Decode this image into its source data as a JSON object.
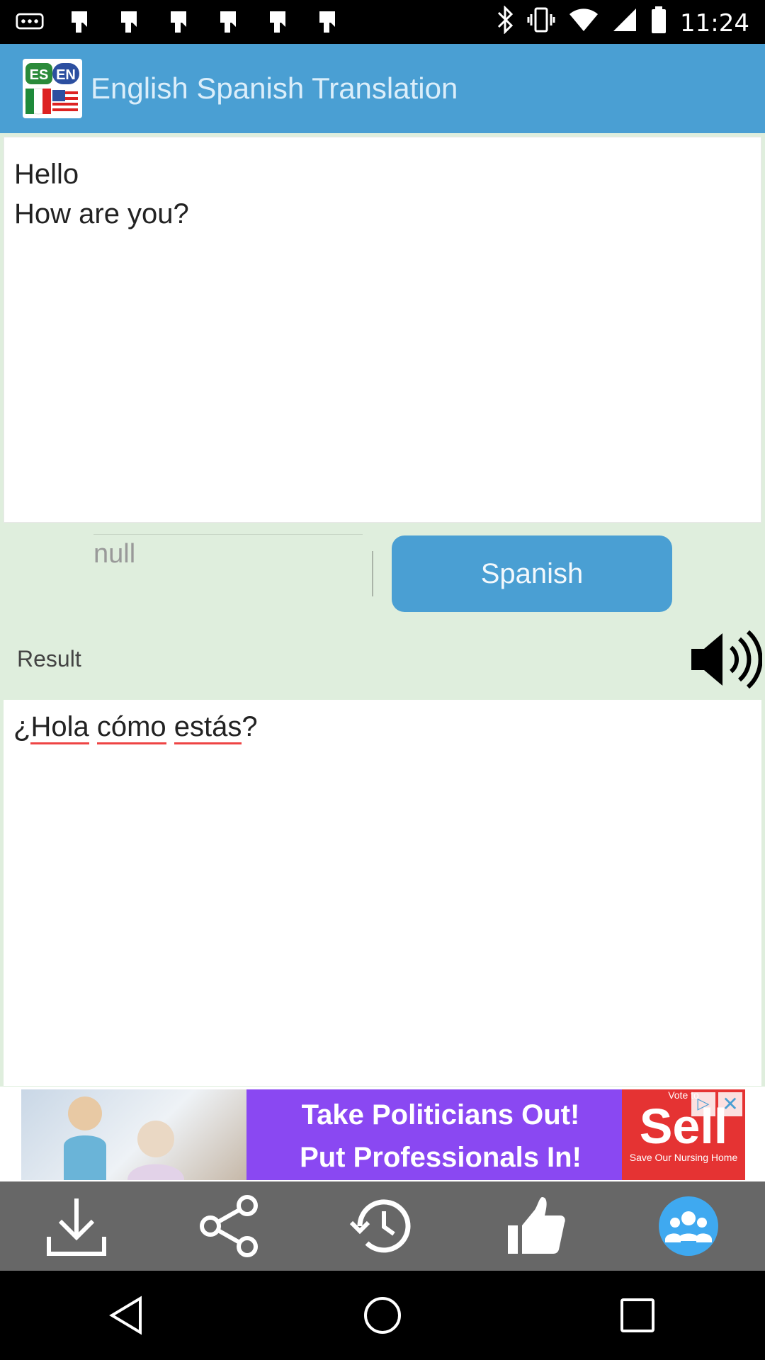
{
  "status_bar": {
    "time": "11:24",
    "left_icons": [
      "more-icon",
      "notification-icon",
      "notification-icon",
      "notification-icon",
      "notification-icon",
      "notification-icon",
      "notification-icon"
    ],
    "right_icons": [
      "bluetooth-icon",
      "vibrate-icon",
      "wifi-icon",
      "signal-icon",
      "battery-icon"
    ]
  },
  "app_bar": {
    "title": "English Spanish Translation",
    "logo_text_es": "ES",
    "logo_text_en": "EN"
  },
  "input": {
    "text": "Hello\nHow are you?"
  },
  "language": {
    "source": "null",
    "target": "Spanish"
  },
  "result": {
    "label": "Result",
    "prefix": "¿",
    "words": [
      "Hola",
      "cómo",
      "estás"
    ],
    "suffix": "?"
  },
  "ad": {
    "line1": "Take Politicians Out!",
    "line2": "Put Professionals In!",
    "logo_top": "Vote to",
    "logo_main": "Sell",
    "logo_bottom": "Save Our Nursing Home"
  },
  "bottom_bar": {
    "icons": [
      "download-icon",
      "share-icon",
      "history-icon",
      "thumbs-up-icon",
      "group-icon"
    ]
  },
  "colors": {
    "accent": "#4a9fd3",
    "background": "#dfeedd",
    "toolbar": "#676767"
  }
}
